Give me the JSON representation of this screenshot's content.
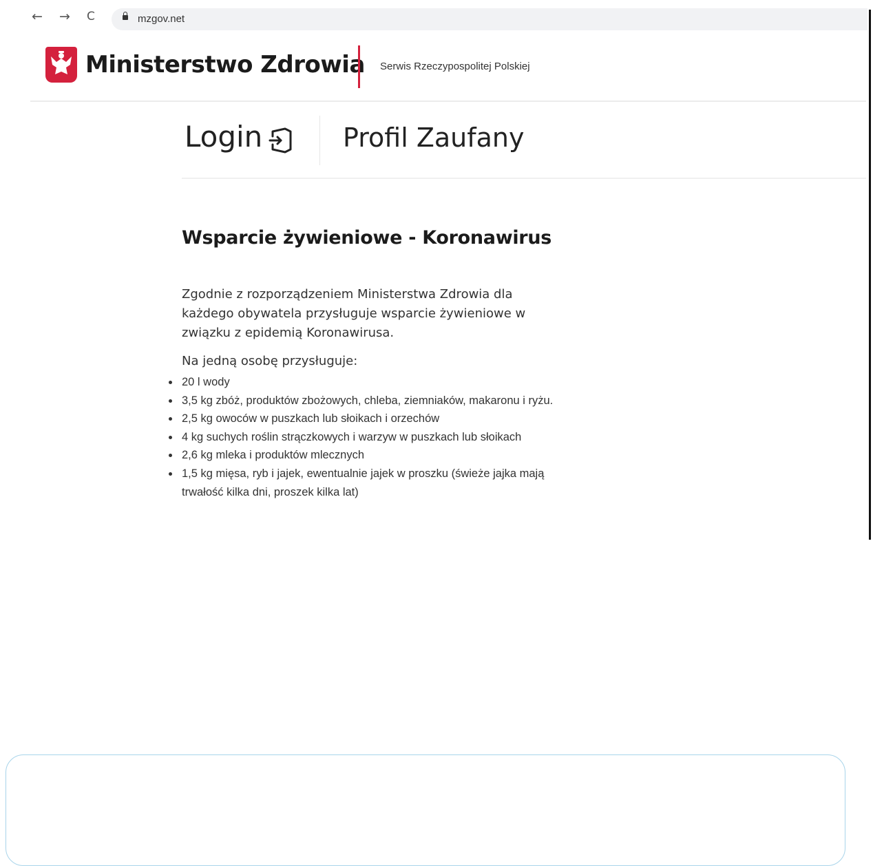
{
  "browser": {
    "url": "mzgov.net",
    "back_icon": "←",
    "forward_icon": "→",
    "reload_icon": "C"
  },
  "header": {
    "brand": "Ministerstwo Zdrowia",
    "subtitle": "Serwis Rzeczypospolitej Polskiej",
    "brand_color": "#d4213d"
  },
  "login": {
    "label": "Login",
    "profile": "Profil Zaufany"
  },
  "content": {
    "title": "Wsparcie żywieniowe - Koronawirus",
    "intro": "Zgodnie z rozporządzeniem Ministerstwa Zdrowia dla każdego obywatela przysługuje wsparcie żywieniowe w związku z epidemią Koronawirusa.",
    "list_heading": "Na jedną osobę przysługuje:",
    "items": [
      "20 l wody",
      "3,5 kg zbóż, produktów zbożowych, chleba, ziemniaków, makaronu i ryżu.",
      "2,5 kg owoców w puszkach lub słoikach i orzechów",
      "4 kg suchych roślin strączkowych i warzyw w puszkach lub słoikach",
      "2,6 kg mleka i produktów mlecznych",
      "1,5 kg mięsa, ryb i jajek, ewentualnie jajek w proszku (świeże jajka mają trwałość kilka dni, proszek kilka lat)"
    ]
  }
}
